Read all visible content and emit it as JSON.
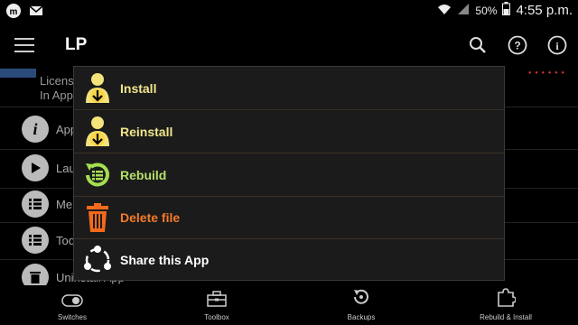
{
  "status_bar": {
    "battery": "50%",
    "time": "4:55 p.m."
  },
  "app_bar": {
    "title": "LP"
  },
  "background": {
    "license_lines": [
      "Licens",
      "In App"
    ],
    "items": [
      {
        "label": "App"
      },
      {
        "label": "Lau"
      },
      {
        "label": "Me"
      },
      {
        "label": "Too"
      },
      {
        "label": "Uninstall App"
      }
    ]
  },
  "popup_menu": {
    "items": [
      {
        "label": "Install",
        "color": "#f0e58c"
      },
      {
        "label": "Reinstall",
        "color": "#f0e58c"
      },
      {
        "label": "Rebuild",
        "color": "#b4e06a"
      },
      {
        "label": "Delete file",
        "color": "#f47a2a"
      },
      {
        "label": "Share this App",
        "color": "#ffffff"
      }
    ]
  },
  "bottom_nav": {
    "items": [
      {
        "label": "Switches"
      },
      {
        "label": "Toolbox"
      },
      {
        "label": "Backups"
      },
      {
        "label": "Rebuild & Install"
      }
    ]
  }
}
